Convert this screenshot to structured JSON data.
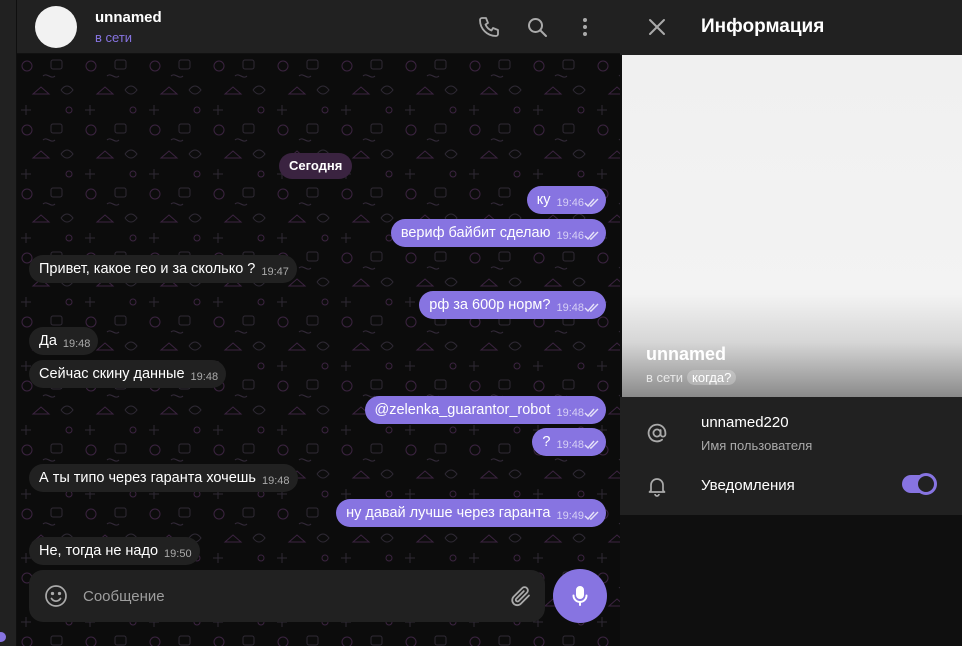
{
  "chat": {
    "header": {
      "name": "unnamed",
      "status": "в сети"
    },
    "date_label": "Сегодня",
    "messages": [
      {
        "text": "ку",
        "time": "19:46",
        "outgoing": true
      },
      {
        "text": "вериф байбит сделаю",
        "time": "19:46",
        "outgoing": true
      },
      {
        "text": "Привет, какое гео и за сколько ?",
        "time": "19:47",
        "outgoing": false
      },
      {
        "text": "рф за 600р норм?",
        "time": "19:48",
        "outgoing": true
      },
      {
        "text": "Да",
        "time": "19:48",
        "outgoing": false
      },
      {
        "text": "Сейчас скину данные",
        "time": "19:48",
        "outgoing": false
      },
      {
        "text": "@zelenka_guarantor_robot",
        "time": "19:48",
        "outgoing": true
      },
      {
        "text": "?",
        "time": "19:48",
        "outgoing": true
      },
      {
        "text": "А ты типо через гаранта хочешь",
        "time": "19:48",
        "outgoing": false
      },
      {
        "text": "ну давай лучше через гаранта",
        "time": "19:49",
        "outgoing": true
      },
      {
        "text": "Не, тогда не надо",
        "time": "19:50",
        "outgoing": false
      }
    ],
    "composer": {
      "placeholder": "Сообщение"
    }
  },
  "panel": {
    "title": "Информация",
    "profile": {
      "name": "unnamed",
      "status": "в сети",
      "status_hint": "когда?"
    },
    "username": {
      "value": "unnamed220",
      "label": "Имя пользователя"
    },
    "notifications": {
      "label": "Уведомления",
      "enabled": true
    }
  },
  "colors": {
    "accent": "#8774e1",
    "outgoing_bubble": "#8774e1",
    "incoming_bubble": "#212121",
    "header_bg": "#212121",
    "chat_bg": "#0c0c0c",
    "date_pill": "#3a2340"
  },
  "icons": [
    "phone-icon",
    "search-icon",
    "more-vertical-icon",
    "close-icon",
    "at-sign-icon",
    "bell-icon",
    "emoji-icon",
    "paperclip-icon",
    "microphone-icon",
    "double-check-icon"
  ]
}
